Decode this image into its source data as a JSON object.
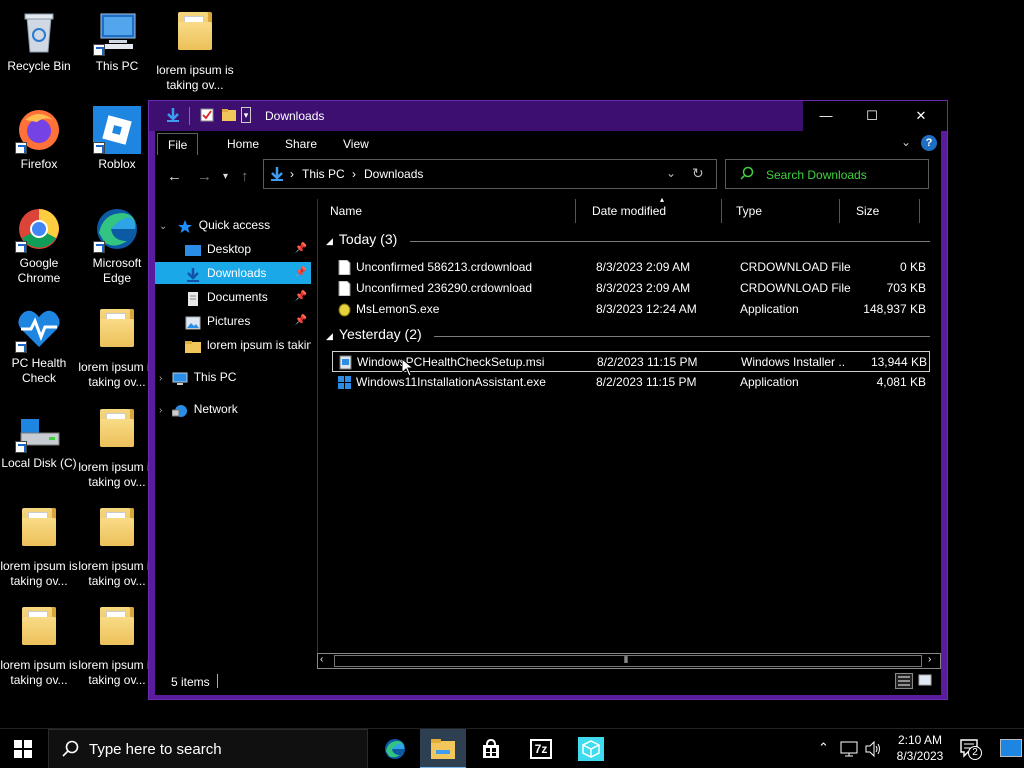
{
  "desktop": {
    "icons": [
      {
        "label": "Recycle Bin"
      },
      {
        "label": "This PC"
      },
      {
        "label": "lorem ipsum is taking ov..."
      },
      {
        "label": "Firefox"
      },
      {
        "label": "Roblox"
      },
      {
        "label": "Google Chrome"
      },
      {
        "label": "Microsoft Edge"
      },
      {
        "label": "PC Health Check"
      },
      {
        "label": "lorem ipsum is taking ov..."
      },
      {
        "label": "Local Disk (C)"
      },
      {
        "label": "lorem ipsum is taking ov..."
      },
      {
        "label": "lorem ipsum is taking ov..."
      },
      {
        "label": "lorem ipsum is taking ov..."
      },
      {
        "label": "lorem ipsum is taking ov..."
      },
      {
        "label": "lorem ipsum is taking ov..."
      }
    ]
  },
  "window": {
    "title": "Downloads",
    "controls": {
      "minimize": "—",
      "maximize": "☐",
      "close": "✕"
    },
    "ribbon": {
      "tabs": [
        "File",
        "Home",
        "Share",
        "View"
      ],
      "help": "?"
    },
    "address": {
      "crumbs": [
        "This PC",
        "Downloads"
      ],
      "separator": "›"
    },
    "search": {
      "placeholder": "Search Downloads"
    },
    "nav": {
      "quick_access": "Quick access",
      "items": [
        "Desktop",
        "Downloads",
        "Documents",
        "Pictures",
        "lorem ipsum is taking ov..."
      ],
      "this_pc": "This PC",
      "network": "Network"
    },
    "columns": [
      "Name",
      "Date modified",
      "Type",
      "Size"
    ],
    "groups": [
      {
        "label": "Today (3)"
      },
      {
        "label": "Yesterday (2)"
      }
    ],
    "files": [
      {
        "name": "Unconfirmed 586213.crdownload",
        "date": "8/3/2023 2:09 AM",
        "type": "CRDOWNLOAD File",
        "size": "0 KB",
        "icon": "document-icon"
      },
      {
        "name": "Unconfirmed 236290.crdownload",
        "date": "8/3/2023 2:09 AM",
        "type": "CRDOWNLOAD File",
        "size": "703 KB",
        "icon": "document-icon"
      },
      {
        "name": "MsLemonS.exe",
        "date": "8/3/2023 12:24 AM",
        "type": "Application",
        "size": "148,937 KB",
        "icon": "lemon-app-icon"
      },
      {
        "name": "WindowsPCHealthCheckSetup.msi",
        "date": "8/2/2023 11:15 PM",
        "type": "Windows Installer ...",
        "size": "13,944 KB",
        "icon": "installer-icon"
      },
      {
        "name": "Windows11InstallationAssistant.exe",
        "date": "8/2/2023 11:15 PM",
        "type": "Application",
        "size": "4,081 KB",
        "icon": "windows-logo-icon"
      }
    ],
    "status": {
      "items": "5 items"
    }
  },
  "taskbar": {
    "search_placeholder": "Type here to search",
    "clock_time": "2:10 AM",
    "clock_date": "8/3/2023",
    "notification_count": "2"
  },
  "colors": {
    "window_frame": "#5a1c9c",
    "selection": "#1aa8e8",
    "search_text": "#3fd23f"
  }
}
